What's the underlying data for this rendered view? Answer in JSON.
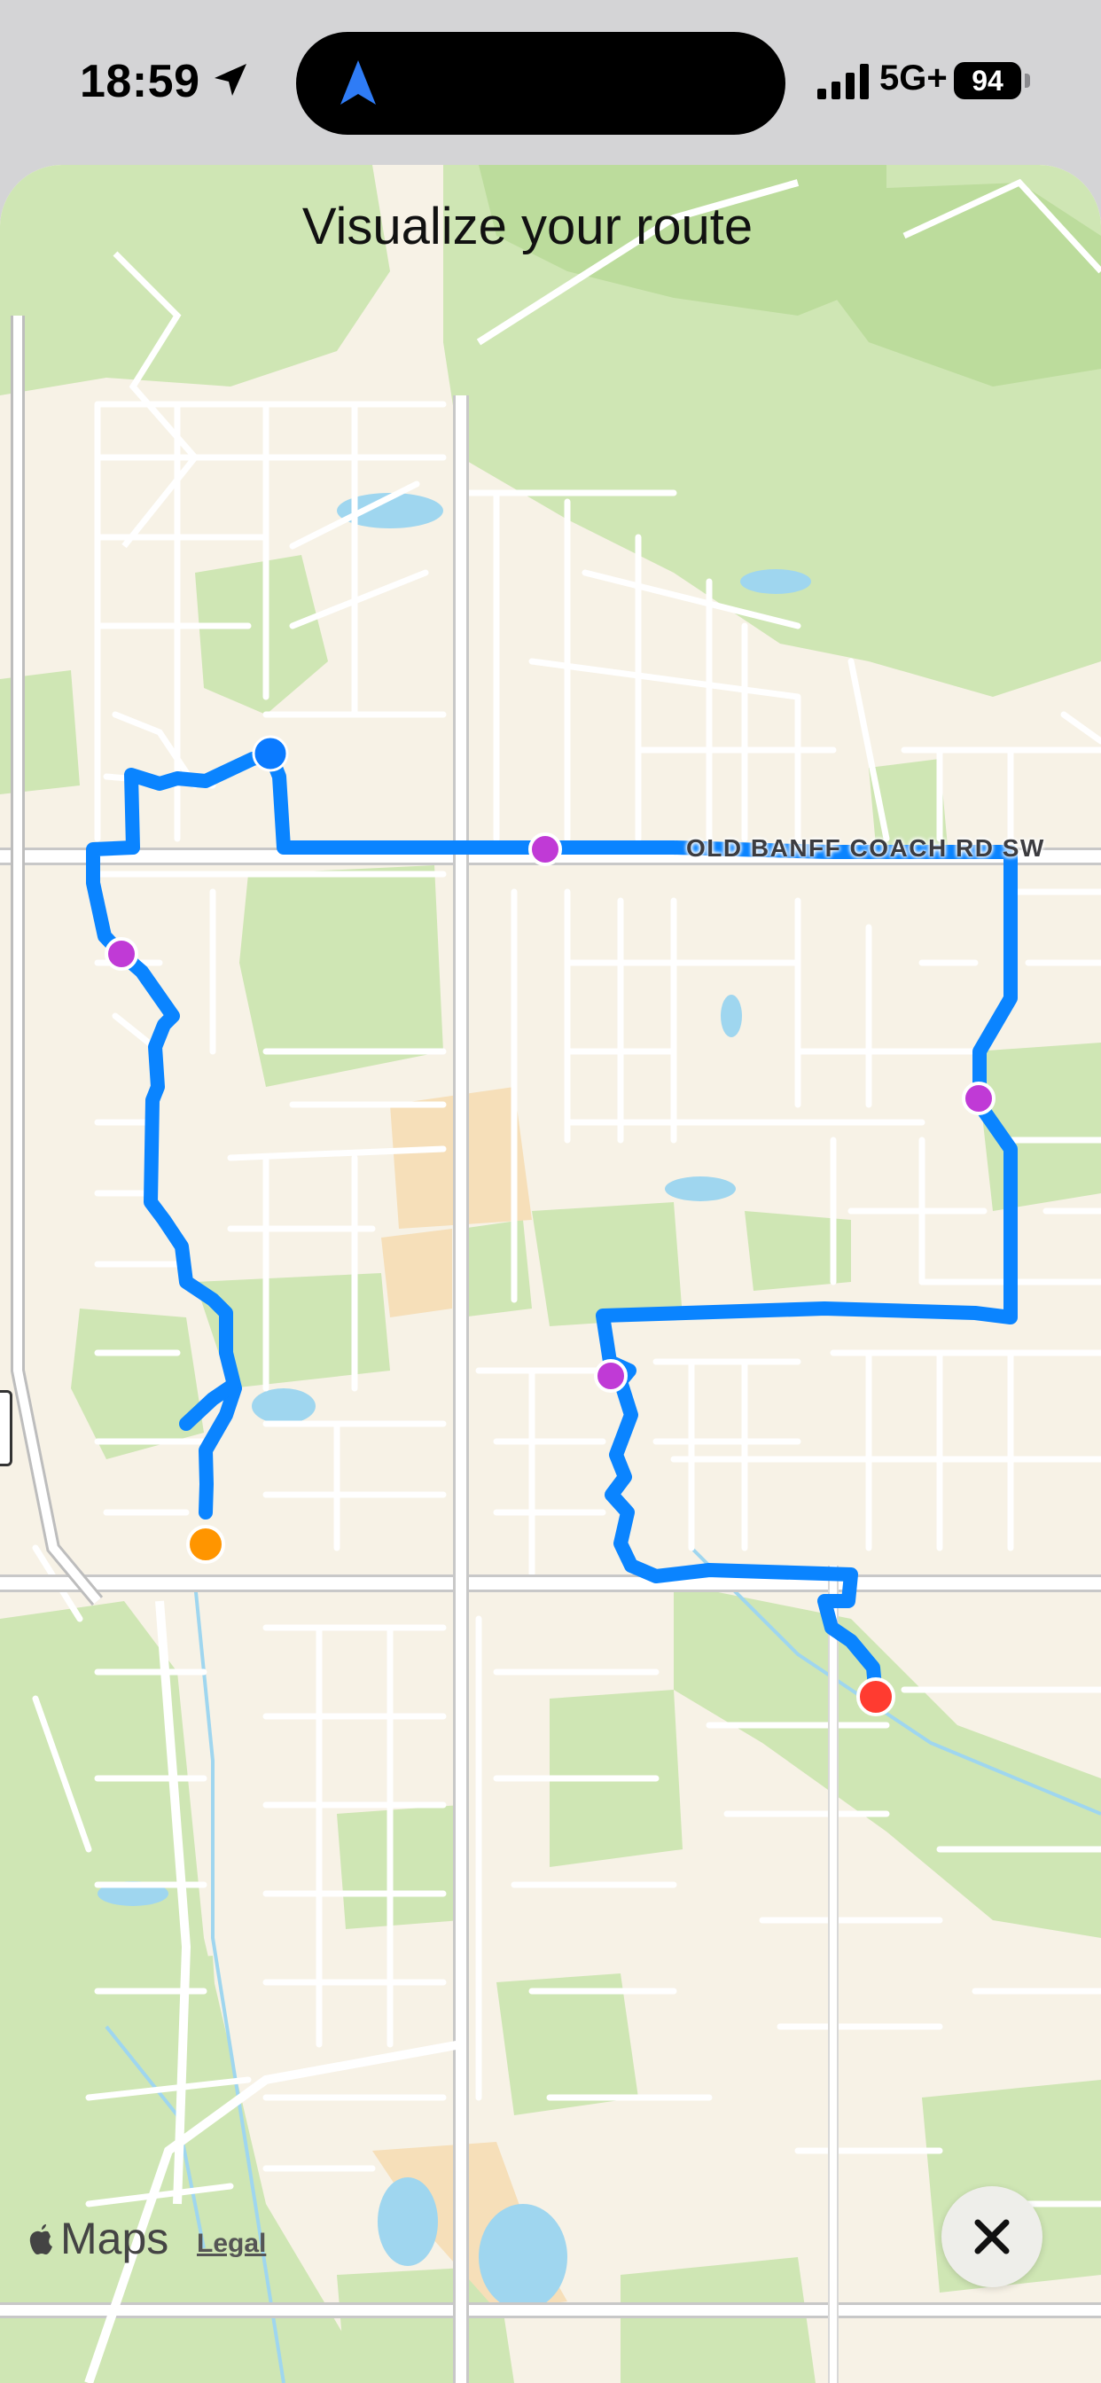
{
  "status_bar": {
    "time": "18:59",
    "network": "5G+",
    "battery": "94",
    "icons": [
      "location-arrow-icon",
      "navigation-icon",
      "signal-bars-icon",
      "battery-icon"
    ]
  },
  "map": {
    "title": "Visualize your route",
    "road_label": "OLD BANFF COACH RD SW",
    "attribution": "Maps",
    "legal": "Legal",
    "route_color": "#0a84ff",
    "markers": [
      {
        "type": "current-location",
        "color": "#0a7aff"
      },
      {
        "type": "start",
        "color": "#ff9500"
      },
      {
        "type": "end",
        "color": "#ff3b30"
      },
      {
        "type": "waypoint",
        "color": "#c03ad6"
      },
      {
        "type": "waypoint",
        "color": "#c03ad6"
      },
      {
        "type": "waypoint",
        "color": "#c03ad6"
      },
      {
        "type": "waypoint",
        "color": "#c03ad6"
      }
    ]
  },
  "controls": {
    "close_icon": "close-icon"
  }
}
